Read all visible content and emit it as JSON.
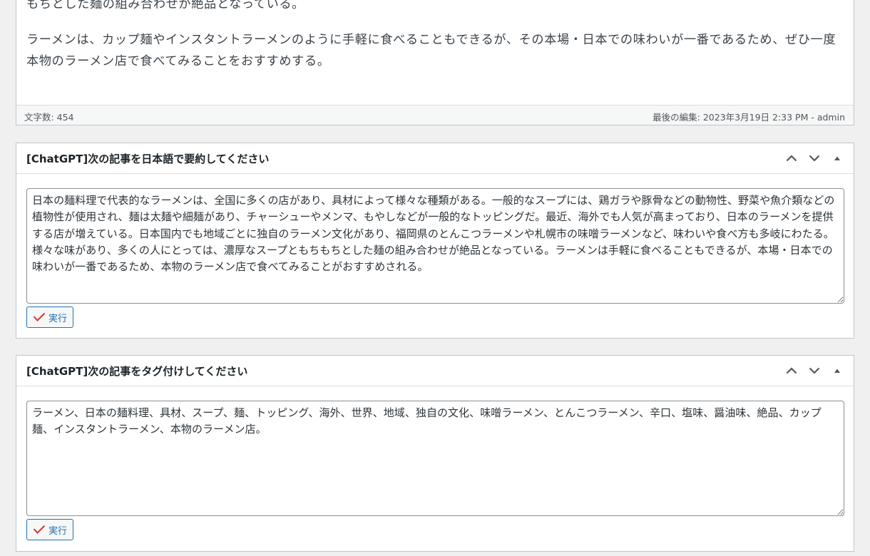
{
  "editor": {
    "paragraphs": [
      "もちとした麺の組み合わせが絶品となっている。",
      "ラーメンは、カップ麺やインスタントラーメンのように手軽に食べることもできるが、その本場・日本での味わいが一番であるため、ぜひ一度本物のラーメン店で食べてみることをおすすめする。"
    ],
    "word_count": "文字数: 454",
    "last_edited": "最後の編集: 2023年3月19日 2:33 PM - admin"
  },
  "summary_box": {
    "title": "[ChatGPT]次の記事を日本語で要約してください",
    "result": "日本の麺料理で代表的なラーメンは、全国に多くの店があり、具材によって様々な種類がある。一般的なスープには、鶏ガラや豚骨などの動物性、野菜や魚介類などの植物性が使用され、麺は太麺や細麺があり、チャーシューやメンマ、もやしなどが一般的なトッピングだ。最近、海外でも人気が高まっており、日本のラーメンを提供する店が増えている。日本国内でも地域ごとに独自のラーメン文化があり、福岡県のとんこつラーメンや札幌市の味噌ラーメンなど、味わいや食べ方も多岐にわたる。様々な味があり、多くの人にとっては、濃厚なスープともちもちとした麺の組み合わせが絶品となっている。ラーメンは手軽に食べることもできるが、本場・日本での味わいが一番であるため、本物のラーメン店で食べてみることがおすすめされる。",
    "run_label": "実行"
  },
  "tag_box": {
    "title": "[ChatGPT]次の記事をタグ付けしてください",
    "result": "ラーメン、日本の麺料理、具材、スープ、麺、トッピング、海外、世界、地域、独自の文化、味噌ラーメン、とんこつラーメン、辛口、塩味、醤油味、絶品、カップ麺、インスタントラーメン、本物のラーメン店。",
    "run_label": "実行"
  },
  "colors": {
    "accent": "#2271b1",
    "check": "#d63638",
    "border": "#c3c4c7",
    "background": "#f0f0f1"
  },
  "icons": {
    "move_up": "chevron-up-icon",
    "move_down": "chevron-down-icon",
    "toggle": "triangle-up-icon",
    "run": "checkmark-icon"
  }
}
